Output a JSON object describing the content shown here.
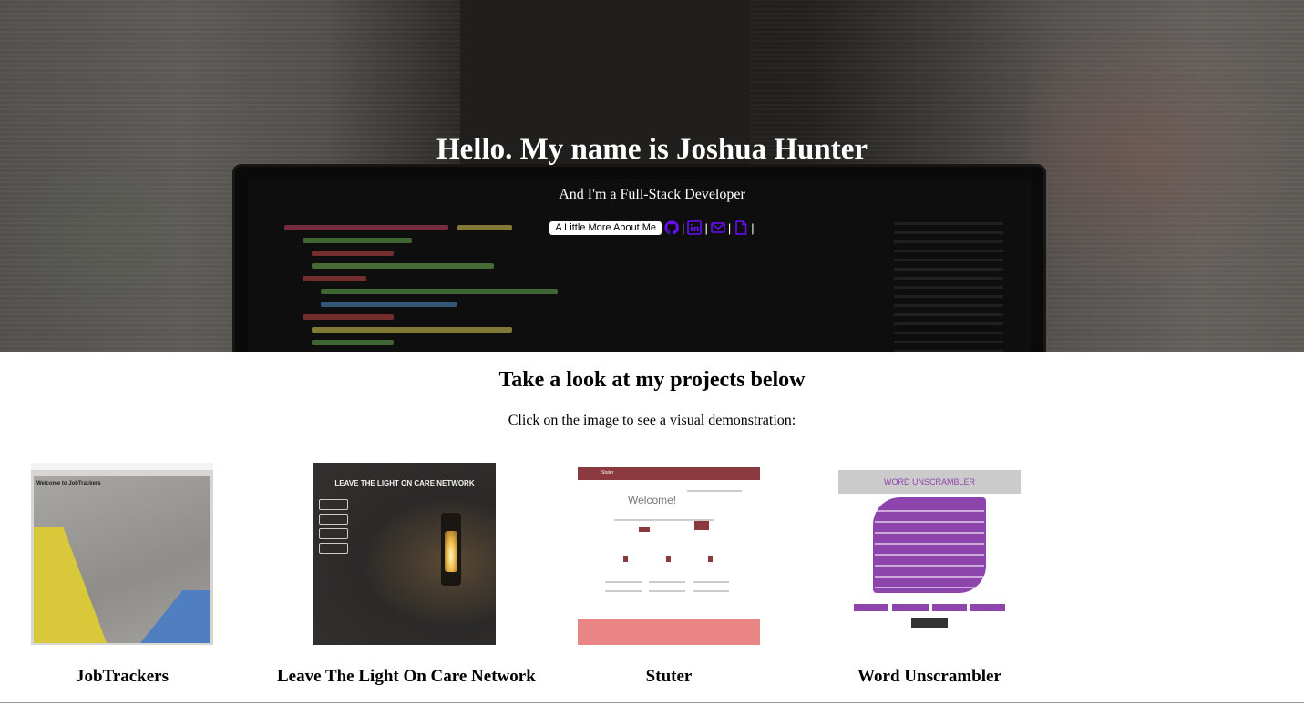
{
  "hero": {
    "title": "Hello. My name is Joshua Hunter",
    "subtitle": "And I'm a Full-Stack Developer",
    "about_button": "A Little More About Me",
    "separator": "|",
    "icons": [
      "github-icon",
      "linkedin-icon",
      "email-icon",
      "resume-icon"
    ],
    "icon_color": "#6a0dff"
  },
  "projects": {
    "heading": "Take a look at my projects below",
    "subheading": "Click on the image to see a visual demonstration:",
    "items": [
      {
        "name": "JobTrackers",
        "thumb": {
          "heading": "Welcome to JobTrackers"
        }
      },
      {
        "name": "Leave The Light On Care Network",
        "thumb": {
          "logo": "LEAVE THE LIGHT ON CARE NETWORK"
        }
      },
      {
        "name": "Stuter",
        "thumb": {
          "brand": "Stuter",
          "welcome": "Welcome!"
        }
      },
      {
        "name": "Word Unscrambler",
        "thumb": {
          "heading": "WORD UNSCRAMBLER"
        }
      }
    ]
  },
  "colors": {
    "hero_text": "#ffffff",
    "stuter_red": "#8a3a3f",
    "stuter_footer": "#e98585",
    "unscrambler_purple": "#8e44ad"
  }
}
